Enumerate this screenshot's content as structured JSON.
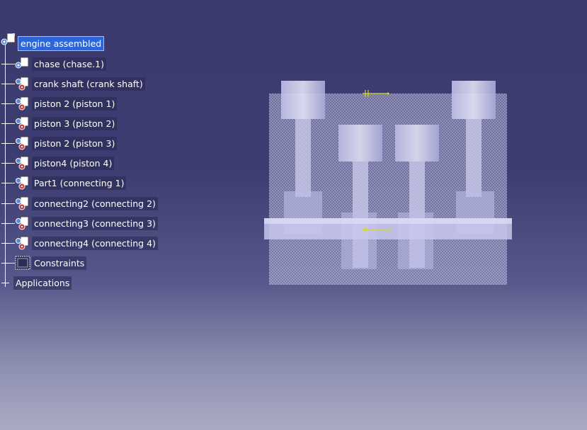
{
  "tree": {
    "root_label": "engine assembled",
    "root_icon": "product-icon",
    "items": [
      {
        "label": "chase (chase.1)",
        "icon": "product-icon"
      },
      {
        "label": "crank shaft (crank shaft)",
        "icon": "part-icon"
      },
      {
        "label": "piston 2 (piston 1)",
        "icon": "part-icon"
      },
      {
        "label": "piston 3 (piston 2)",
        "icon": "part-icon"
      },
      {
        "label": "piston 2 (piston 3)",
        "icon": "part-icon"
      },
      {
        "label": "piston4 (piston 4)",
        "icon": "part-icon"
      },
      {
        "label": "Part1 (connecting 1)",
        "icon": "part-icon"
      },
      {
        "label": "connecting2 (connecting 2)",
        "icon": "part-icon"
      },
      {
        "label": "connecting3 (connecting 3)",
        "icon": "part-icon"
      },
      {
        "label": "connecting4 (connecting 4)",
        "icon": "part-icon"
      }
    ],
    "constraints_label": "Constraints",
    "constraints_icon": "constraints-icon",
    "applications_label": "Applications"
  },
  "colors": {
    "background_top": "#3b3a6e",
    "background_bottom": "#a9abc4",
    "selection": "#2c66d9",
    "model": "#c8c8ea"
  }
}
